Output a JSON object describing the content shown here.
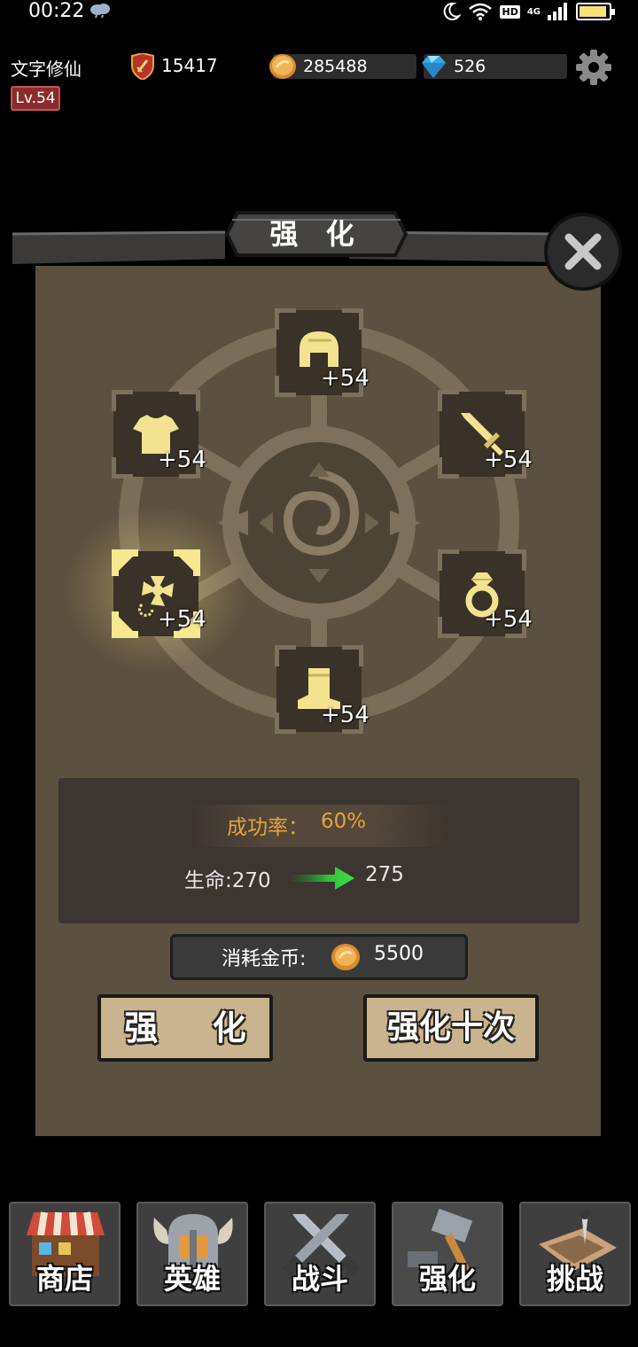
{
  "status_bar": {
    "time": "00:22",
    "hd": "HD",
    "network": "4G"
  },
  "player": {
    "name": "文字修仙",
    "level": "Lv.54",
    "power": "15417"
  },
  "resources": {
    "gold": "285488",
    "gems": "526"
  },
  "panel": {
    "title": "强 化",
    "slots": [
      {
        "id": "helmet",
        "level": "+54"
      },
      {
        "id": "armor",
        "level": "+54"
      },
      {
        "id": "weapon",
        "level": "+54"
      },
      {
        "id": "necklace",
        "level": "+54",
        "selected": true
      },
      {
        "id": "ring",
        "level": "+54"
      },
      {
        "id": "boots",
        "level": "+54"
      }
    ],
    "success_label": "成功率：",
    "success_rate": "60%",
    "stat_from": "生命:270",
    "stat_to": "275",
    "cost_label": "消耗金币:",
    "cost_value": "5500",
    "btn_enhance": "强 化",
    "btn_enhance_ten": "强化十次"
  },
  "nav": [
    {
      "label": "商店",
      "icon": "shop-icon"
    },
    {
      "label": "英雄",
      "icon": "hero-helmet-icon"
    },
    {
      "label": "战斗",
      "icon": "crossed-swords-icon"
    },
    {
      "label": "强化",
      "icon": "hammer-icon",
      "active": true
    },
    {
      "label": "挑战",
      "icon": "challenge-map-icon"
    }
  ],
  "colors": {
    "panel": "#5c5040",
    "gold_text": "#e3a43a",
    "item_yellow": "#f3e28f",
    "button": "#c9b48f"
  }
}
